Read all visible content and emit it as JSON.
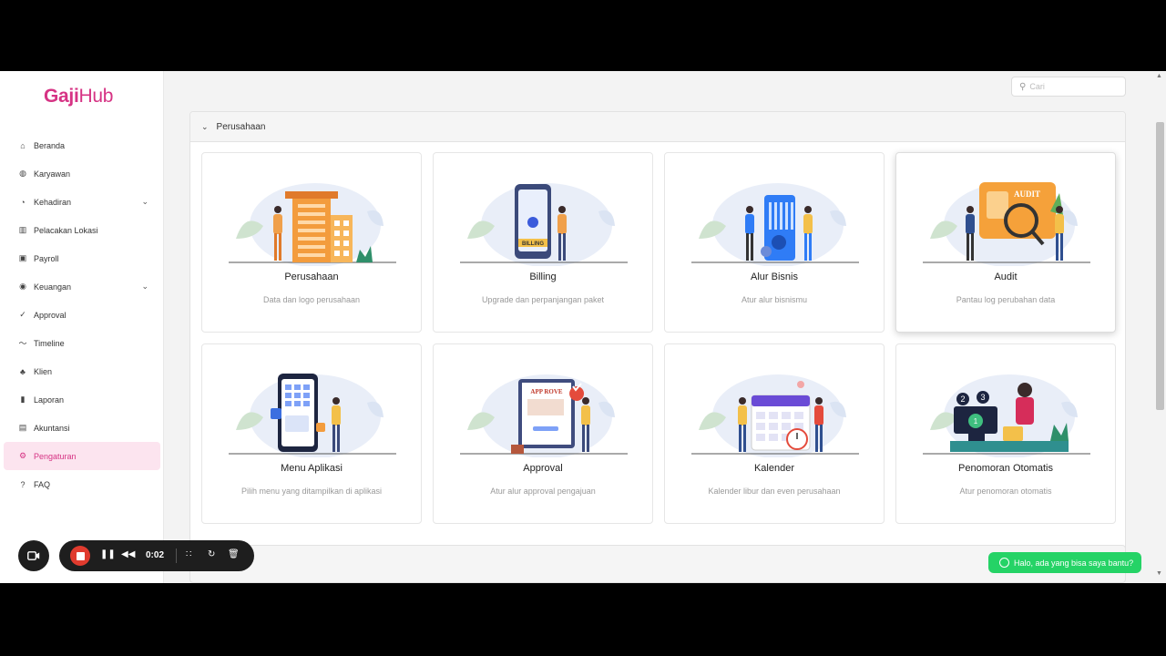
{
  "app": {
    "logo_bold": "Gaji",
    "logo_light": "Hub"
  },
  "sidebar": {
    "items": [
      {
        "label": "Beranda",
        "icon": "home-icon",
        "glyph": "⌂"
      },
      {
        "label": "Karyawan",
        "icon": "users-icon",
        "glyph": "◍"
      },
      {
        "label": "Kehadiran",
        "icon": "clock-icon",
        "glyph": "◔",
        "expandable": true
      },
      {
        "label": "Pelacakan Lokasi",
        "icon": "map-icon",
        "glyph": "▥"
      },
      {
        "label": "Payroll",
        "icon": "payroll-icon",
        "glyph": "▣"
      },
      {
        "label": "Keuangan",
        "icon": "money-icon",
        "glyph": "◉",
        "expandable": true
      },
      {
        "label": "Approval",
        "icon": "check-circle-icon",
        "glyph": "✓"
      },
      {
        "label": "Timeline",
        "icon": "timeline-icon",
        "glyph": "〜"
      },
      {
        "label": "Klien",
        "icon": "client-icon",
        "glyph": "♣"
      },
      {
        "label": "Laporan",
        "icon": "report-icon",
        "glyph": "▮"
      },
      {
        "label": "Akuntansi",
        "icon": "accounting-icon",
        "glyph": "▤"
      },
      {
        "label": "Pengaturan",
        "icon": "settings-icon",
        "glyph": "⚙",
        "active": true
      },
      {
        "label": "FAQ",
        "icon": "question-icon",
        "glyph": "?"
      }
    ]
  },
  "search": {
    "placeholder": "Cari"
  },
  "section": {
    "title": "Perusahaan"
  },
  "cards": [
    {
      "title": "Perusahaan",
      "desc": "Data dan logo perusahaan",
      "icon": "company-illustration"
    },
    {
      "title": "Billing",
      "desc": "Upgrade dan perpanjangan paket",
      "icon": "billing-illustration",
      "art_text": "BILLING"
    },
    {
      "title": "Alur Bisnis",
      "desc": "Atur alur bisnismu",
      "icon": "business-flow-illustration"
    },
    {
      "title": "Audit",
      "desc": "Pantau log perubahan data",
      "icon": "audit-illustration",
      "art_text": "AUDIT",
      "highlight": true
    },
    {
      "title": "Menu Aplikasi",
      "desc": "Pilih menu yang ditampilkan di aplikasi",
      "icon": "app-menu-illustration"
    },
    {
      "title": "Approval",
      "desc": "Atur alur approval pengajuan",
      "icon": "approval-illustration",
      "art_text": "APP ROVE"
    },
    {
      "title": "Kalender",
      "desc": "Kalender libur dan even perusahaan",
      "icon": "calendar-illustration"
    },
    {
      "title": "Penomoran Otomatis",
      "desc": "Atur penomoran otomatis",
      "icon": "auto-numbering-illustration",
      "art_text": [
        "2",
        "3",
        "1"
      ]
    }
  ],
  "chat": {
    "label": "Halo, ada yang bisa saya bantu?"
  },
  "recorder": {
    "time": "0:02"
  },
  "colors": {
    "brand": "#d63384",
    "active_bg": "#fce4ef",
    "whatsapp": "#25d366",
    "record": "#e03b2e"
  }
}
